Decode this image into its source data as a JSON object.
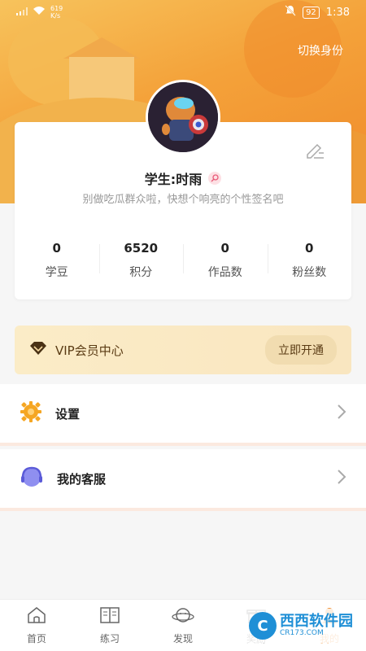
{
  "status_bar": {
    "network_speed": "619",
    "network_unit": "K/s",
    "battery": "92",
    "time": "1:38"
  },
  "header": {
    "switch_identity": "切换身份"
  },
  "profile": {
    "name": "学生:时雨",
    "signature": "别做吃瓜群众啦，快想个响亮的个性签名吧"
  },
  "stats": [
    {
      "value": "0",
      "label": "学豆"
    },
    {
      "value": "6520",
      "label": "积分"
    },
    {
      "value": "0",
      "label": "作品数"
    },
    {
      "value": "0",
      "label": "粉丝数"
    }
  ],
  "vip": {
    "label": "VIP会员中心",
    "button": "立即开通"
  },
  "menu": [
    {
      "label": "设置",
      "icon": "settings-gear-icon"
    },
    {
      "label": "我的客服",
      "icon": "headset-icon"
    }
  ],
  "tabs": [
    {
      "label": "首页",
      "icon": "home-icon"
    },
    {
      "label": "练习",
      "icon": "book-icon"
    },
    {
      "label": "发现",
      "icon": "planet-icon"
    },
    {
      "label": "奖励",
      "icon": "gift-icon"
    },
    {
      "label": "我的",
      "icon": "profile-icon"
    }
  ],
  "watermark": {
    "main": "西西软件园",
    "sub": "CR173.COM"
  },
  "colors": {
    "accent": "#f08a2a",
    "vip_text": "#5a3b14",
    "menu_separator": "#fbe9df"
  }
}
